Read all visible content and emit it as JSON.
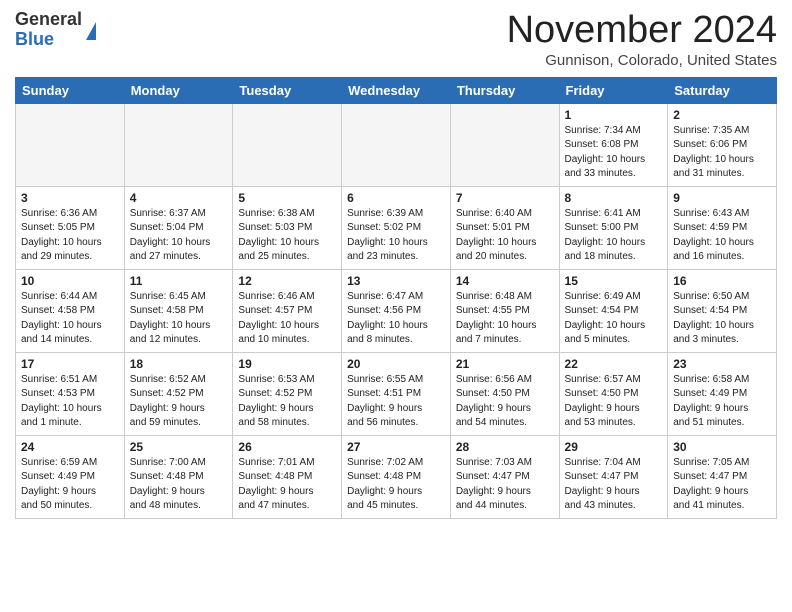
{
  "header": {
    "logo_general": "General",
    "logo_blue": "Blue",
    "month_title": "November 2024",
    "location": "Gunnison, Colorado, United States"
  },
  "days_of_week": [
    "Sunday",
    "Monday",
    "Tuesday",
    "Wednesday",
    "Thursday",
    "Friday",
    "Saturday"
  ],
  "weeks": [
    [
      {
        "day": "",
        "info": ""
      },
      {
        "day": "",
        "info": ""
      },
      {
        "day": "",
        "info": ""
      },
      {
        "day": "",
        "info": ""
      },
      {
        "day": "",
        "info": ""
      },
      {
        "day": "1",
        "info": "Sunrise: 7:34 AM\nSunset: 6:08 PM\nDaylight: 10 hours\nand 33 minutes."
      },
      {
        "day": "2",
        "info": "Sunrise: 7:35 AM\nSunset: 6:06 PM\nDaylight: 10 hours\nand 31 minutes."
      }
    ],
    [
      {
        "day": "3",
        "info": "Sunrise: 6:36 AM\nSunset: 5:05 PM\nDaylight: 10 hours\nand 29 minutes."
      },
      {
        "day": "4",
        "info": "Sunrise: 6:37 AM\nSunset: 5:04 PM\nDaylight: 10 hours\nand 27 minutes."
      },
      {
        "day": "5",
        "info": "Sunrise: 6:38 AM\nSunset: 5:03 PM\nDaylight: 10 hours\nand 25 minutes."
      },
      {
        "day": "6",
        "info": "Sunrise: 6:39 AM\nSunset: 5:02 PM\nDaylight: 10 hours\nand 23 minutes."
      },
      {
        "day": "7",
        "info": "Sunrise: 6:40 AM\nSunset: 5:01 PM\nDaylight: 10 hours\nand 20 minutes."
      },
      {
        "day": "8",
        "info": "Sunrise: 6:41 AM\nSunset: 5:00 PM\nDaylight: 10 hours\nand 18 minutes."
      },
      {
        "day": "9",
        "info": "Sunrise: 6:43 AM\nSunset: 4:59 PM\nDaylight: 10 hours\nand 16 minutes."
      }
    ],
    [
      {
        "day": "10",
        "info": "Sunrise: 6:44 AM\nSunset: 4:58 PM\nDaylight: 10 hours\nand 14 minutes."
      },
      {
        "day": "11",
        "info": "Sunrise: 6:45 AM\nSunset: 4:58 PM\nDaylight: 10 hours\nand 12 minutes."
      },
      {
        "day": "12",
        "info": "Sunrise: 6:46 AM\nSunset: 4:57 PM\nDaylight: 10 hours\nand 10 minutes."
      },
      {
        "day": "13",
        "info": "Sunrise: 6:47 AM\nSunset: 4:56 PM\nDaylight: 10 hours\nand 8 minutes."
      },
      {
        "day": "14",
        "info": "Sunrise: 6:48 AM\nSunset: 4:55 PM\nDaylight: 10 hours\nand 7 minutes."
      },
      {
        "day": "15",
        "info": "Sunrise: 6:49 AM\nSunset: 4:54 PM\nDaylight: 10 hours\nand 5 minutes."
      },
      {
        "day": "16",
        "info": "Sunrise: 6:50 AM\nSunset: 4:54 PM\nDaylight: 10 hours\nand 3 minutes."
      }
    ],
    [
      {
        "day": "17",
        "info": "Sunrise: 6:51 AM\nSunset: 4:53 PM\nDaylight: 10 hours\nand 1 minute."
      },
      {
        "day": "18",
        "info": "Sunrise: 6:52 AM\nSunset: 4:52 PM\nDaylight: 9 hours\nand 59 minutes."
      },
      {
        "day": "19",
        "info": "Sunrise: 6:53 AM\nSunset: 4:52 PM\nDaylight: 9 hours\nand 58 minutes."
      },
      {
        "day": "20",
        "info": "Sunrise: 6:55 AM\nSunset: 4:51 PM\nDaylight: 9 hours\nand 56 minutes."
      },
      {
        "day": "21",
        "info": "Sunrise: 6:56 AM\nSunset: 4:50 PM\nDaylight: 9 hours\nand 54 minutes."
      },
      {
        "day": "22",
        "info": "Sunrise: 6:57 AM\nSunset: 4:50 PM\nDaylight: 9 hours\nand 53 minutes."
      },
      {
        "day": "23",
        "info": "Sunrise: 6:58 AM\nSunset: 4:49 PM\nDaylight: 9 hours\nand 51 minutes."
      }
    ],
    [
      {
        "day": "24",
        "info": "Sunrise: 6:59 AM\nSunset: 4:49 PM\nDaylight: 9 hours\nand 50 minutes."
      },
      {
        "day": "25",
        "info": "Sunrise: 7:00 AM\nSunset: 4:48 PM\nDaylight: 9 hours\nand 48 minutes."
      },
      {
        "day": "26",
        "info": "Sunrise: 7:01 AM\nSunset: 4:48 PM\nDaylight: 9 hours\nand 47 minutes."
      },
      {
        "day": "27",
        "info": "Sunrise: 7:02 AM\nSunset: 4:48 PM\nDaylight: 9 hours\nand 45 minutes."
      },
      {
        "day": "28",
        "info": "Sunrise: 7:03 AM\nSunset: 4:47 PM\nDaylight: 9 hours\nand 44 minutes."
      },
      {
        "day": "29",
        "info": "Sunrise: 7:04 AM\nSunset: 4:47 PM\nDaylight: 9 hours\nand 43 minutes."
      },
      {
        "day": "30",
        "info": "Sunrise: 7:05 AM\nSunset: 4:47 PM\nDaylight: 9 hours\nand 41 minutes."
      }
    ]
  ]
}
